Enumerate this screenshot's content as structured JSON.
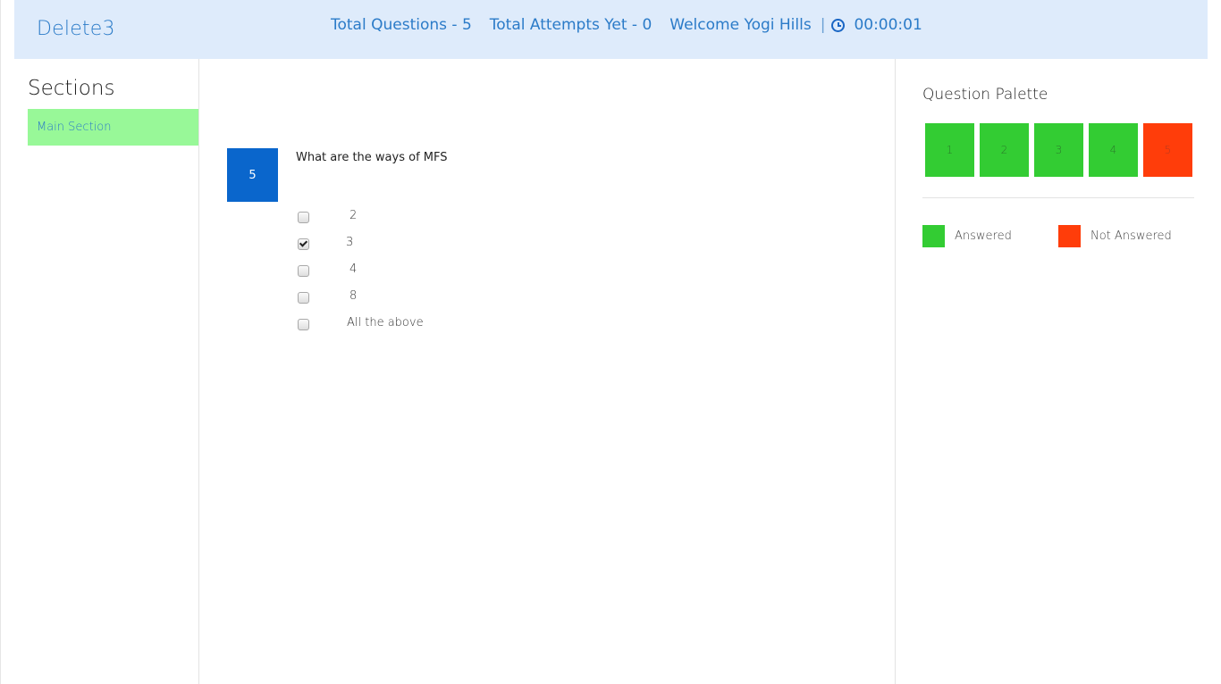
{
  "header": {
    "title": "Delete3",
    "total_questions": "Total Questions - 5",
    "total_attempts": "Total Attempts Yet - 0",
    "welcome": "Welcome Yogi Hills",
    "separator": "|",
    "timer": "00:00:01"
  },
  "sidebar": {
    "title": "Sections",
    "items": [
      {
        "label": "Main Section"
      }
    ]
  },
  "question": {
    "number": "5",
    "text": "What are the ways of MFS",
    "options": [
      {
        "label": "2",
        "checked": false
      },
      {
        "label": "3",
        "checked": true
      },
      {
        "label": "4",
        "checked": false
      },
      {
        "label": "8",
        "checked": false
      },
      {
        "label": "All the above",
        "checked": false
      }
    ]
  },
  "palette": {
    "title": "Question Palette",
    "buttons": [
      {
        "label": "1",
        "status": "answered"
      },
      {
        "label": "2",
        "status": "answered"
      },
      {
        "label": "3",
        "status": "answered"
      },
      {
        "label": "4",
        "status": "answered"
      },
      {
        "label": "5",
        "status": "not-answered"
      }
    ],
    "legend": [
      {
        "label": "Answered",
        "color": "#33cc33"
      },
      {
        "label": "Not Answered",
        "color": "#ff3d0a"
      }
    ]
  },
  "colors": {
    "header_bg": "#deebfb",
    "accent_blue": "#2b7bc8",
    "question_badge": "#0a66cc",
    "section_active": "#98f898",
    "answered": "#33cc33",
    "not_answered": "#ff3d0a"
  }
}
